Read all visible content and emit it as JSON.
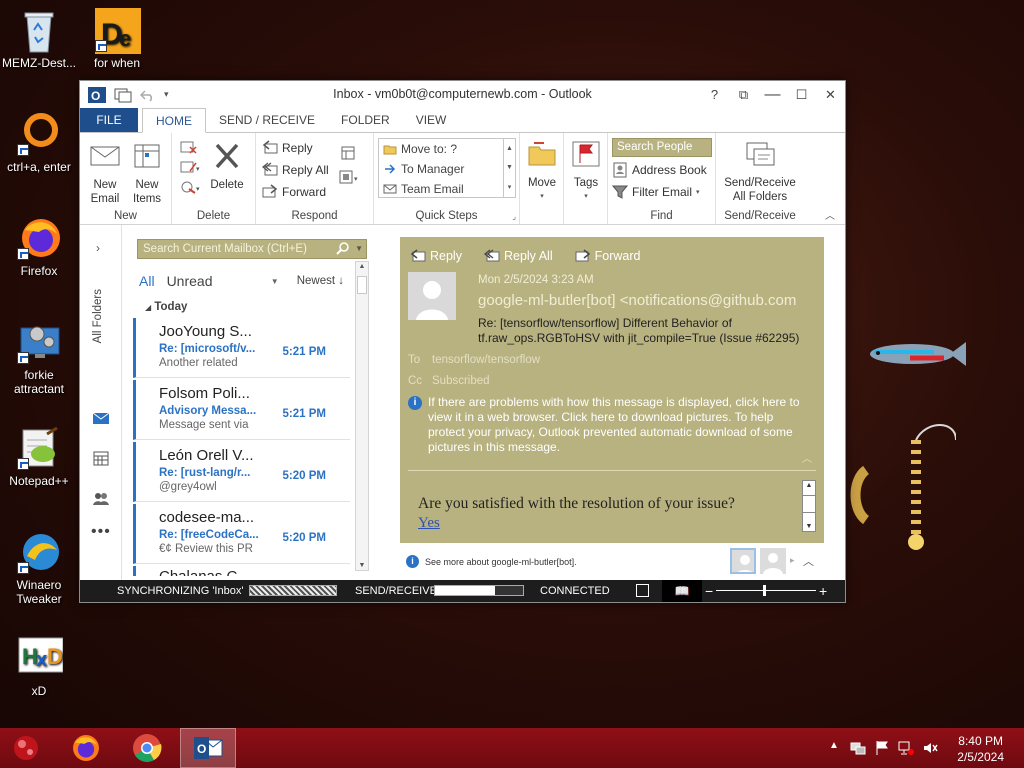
{
  "desktop": {
    "icons": [
      {
        "label": "MEMZ-Dest..."
      },
      {
        "label": "for when"
      },
      {
        "label": "ctrl+a, enter"
      },
      {
        "label": "Firefox"
      },
      {
        "label": "forkie attractant"
      },
      {
        "label": "Notepad++"
      },
      {
        "label": "Winaero Tweaker"
      },
      {
        "label": "xD"
      }
    ]
  },
  "window": {
    "title": "Inbox - vm0b0t@computernewb.com - Outlook",
    "controls": {
      "help": "?",
      "restore": "⧉",
      "maximize": "☐",
      "close": "✕"
    }
  },
  "tabs": [
    "FILE",
    "HOME",
    "SEND / RECEIVE",
    "FOLDER",
    "VIEW"
  ],
  "ribbon": {
    "new": {
      "new_email": "New Email",
      "new_items": "New Items",
      "label": "New"
    },
    "delete": {
      "delete": "Delete",
      "label": "Delete"
    },
    "respond": {
      "reply": "Reply",
      "reply_all": "Reply All",
      "forward": "Forward",
      "label": "Respond"
    },
    "quick_steps": {
      "items": [
        "Move to: ?",
        "To Manager",
        "Team Email"
      ],
      "label": "Quick Steps"
    },
    "move": {
      "label": "Move"
    },
    "tags": {
      "label": "Tags"
    },
    "find": {
      "search_people": "Search People",
      "address_book": "Address Book",
      "filter_email": "Filter Email",
      "label": "Find"
    },
    "send_receive": {
      "button": "Send/Receive All Folders",
      "label": "Send/Receive"
    }
  },
  "nav": {
    "all_folders": "All Folders"
  },
  "maillist": {
    "search_placeholder": "Search Current Mailbox (Ctrl+E)",
    "filter_all": "All",
    "filter_unread": "Unread",
    "sort": "Newest ↓",
    "group": "Today",
    "messages": [
      {
        "from": "JooYoung S...",
        "subject": "Re: [microsoft/v...",
        "preview": "Another related",
        "time": "5:21 PM"
      },
      {
        "from": "Folsom Poli...",
        "subject": "Advisory Messa...",
        "preview": "Message sent via",
        "time": "5:21 PM"
      },
      {
        "from": "León Orell V...",
        "subject": "Re: [rust-lang/r...",
        "preview": "@grey4owl",
        "time": "5:20 PM"
      },
      {
        "from": "codesee-ma...",
        "subject": "Re: [freeCodeCa...",
        "preview": "€¢ Review this PR",
        "time": "5:20 PM"
      },
      {
        "from": "Chalanas C...",
        "subject": "",
        "preview": "",
        "time": ""
      }
    ]
  },
  "reading": {
    "actions": {
      "reply": "Reply",
      "reply_all": "Reply All",
      "forward": "Forward"
    },
    "date": "Mon 2/5/2024 3:23 AM",
    "from": "google-ml-butler[bot] <notifications@github.com",
    "subject": "Re: [tensorflow/tensorflow] Different Behavior of tf.raw_ops.RGBToHSV with jit_compile=True (Issue #62295)",
    "to_label": "To",
    "to": "tensorflow/tensorflow",
    "cc_label": "Cc",
    "cc": "Subscribed",
    "info": "If there are problems with how this message is displayed, click here to view it in a web browser. Click here to download pictures. To help protect your privacy, Outlook prevented automatic download of some pictures in this message.",
    "body_question": "Are you satisfied with the resolution of your issue?",
    "body_link": "Yes",
    "footer": "See more about google-ml-butler[bot]."
  },
  "status": {
    "sync": "SYNCHRONIZING  'Inbox'",
    "send_receive": "SEND/RECEIVE",
    "send_receive_progress": 0.68,
    "connected": "CONNECTED",
    "zoom_minus": "−",
    "zoom_plus": "+"
  },
  "taskbar": {
    "time": "8:40 PM",
    "date": "2/5/2024"
  },
  "colors": {
    "outlook_blue": "#1e4e8c",
    "accent": "#2b72c5",
    "khaki": "#b8b280",
    "taskbar": "#8f0f16"
  }
}
